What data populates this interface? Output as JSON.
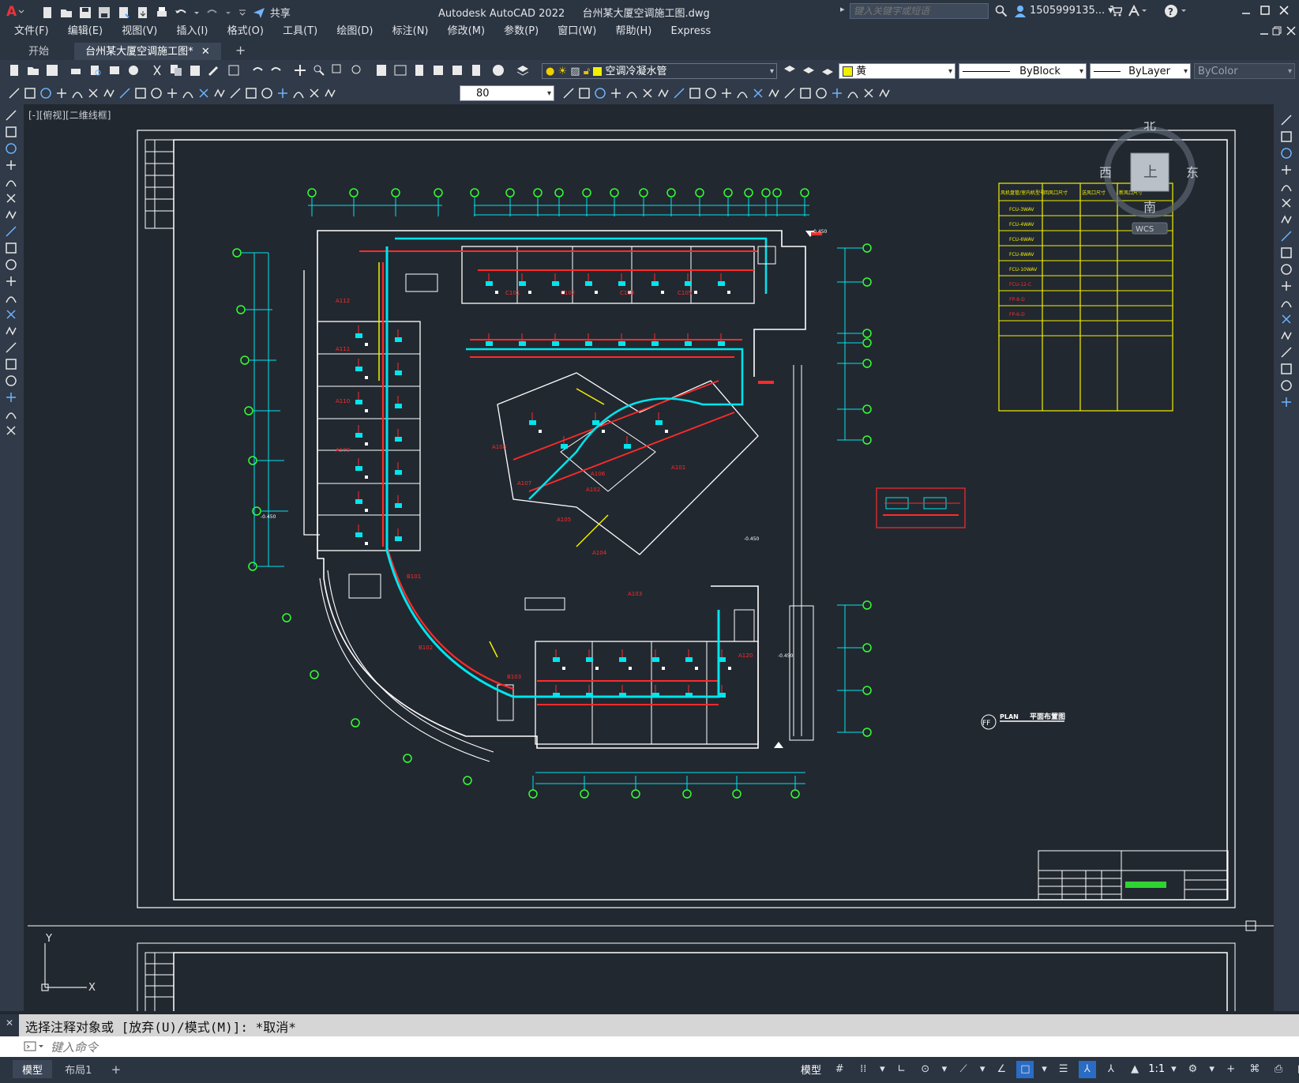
{
  "app": {
    "title": "Autodesk AutoCAD 2022",
    "document": "台州某大厦空调施工图.dwg",
    "share_label": "共享",
    "search_placeholder": "键入关键字或短语",
    "user": "1505999135..."
  },
  "menu": [
    "文件(F)",
    "编辑(E)",
    "视图(V)",
    "插入(I)",
    "格式(O)",
    "工具(T)",
    "绘图(D)",
    "标注(N)",
    "修改(M)",
    "参数(P)",
    "窗口(W)",
    "帮助(H)",
    "Express"
  ],
  "tabs": [
    {
      "label": "开始",
      "active": false
    },
    {
      "label": "台州某大厦空调施工图*",
      "active": true
    }
  ],
  "properties": {
    "layer": "空调冷凝水管",
    "color": "黄",
    "linetype": "ByBlock",
    "lineweight": "ByLayer",
    "plotstyle": "ByColor",
    "dim_value": "80"
  },
  "viewport": {
    "label": "[-][俯视][二维线框]",
    "viewcube": {
      "north": "北",
      "south": "南",
      "east": "东",
      "west": "西",
      "face": "上",
      "wcs": "WCS"
    }
  },
  "drawing": {
    "room_labels": [
      "C101",
      "C102",
      "C103",
      "C105",
      "A112",
      "A111",
      "A110",
      "A109",
      "A108",
      "A107",
      "A106",
      "A105",
      "A104",
      "A103",
      "A102",
      "A101",
      "B101",
      "B102",
      "B103",
      "A120"
    ],
    "elevations": [
      "-0.450",
      "-0.450",
      "-0.450",
      "-0.450"
    ],
    "plan_title": "平面布置图",
    "plan_tag": "PLAN",
    "plan_symbol": "FF",
    "schedule_headers": [
      "风机盘管/室内机型号",
      "回风口尺寸",
      "送风口尺寸",
      "新风口尺寸"
    ],
    "schedule_rows": [
      "FCU-3WAV",
      "FCU-4WAV",
      "FCU-6WAV",
      "FCU-8WAV",
      "FCU-10WAV",
      "FCU-12-C",
      "FP-8-D",
      "FP-6-D"
    ]
  },
  "ucs": {
    "x": "X",
    "y": "Y"
  },
  "command": {
    "history": "选择注释对象或 [放弃(U)/模式(M)]: *取消*",
    "placeholder": "键入命令"
  },
  "layout_tabs": [
    "模型",
    "布局1"
  ],
  "status": {
    "model": "模型",
    "scale": "1:1"
  },
  "colors": {
    "background": "#222830",
    "cyan": "#00e5ee",
    "red": "#ff2a2a",
    "green": "#33ff33",
    "yellow": "#f0f000",
    "white": "#ffffff"
  }
}
